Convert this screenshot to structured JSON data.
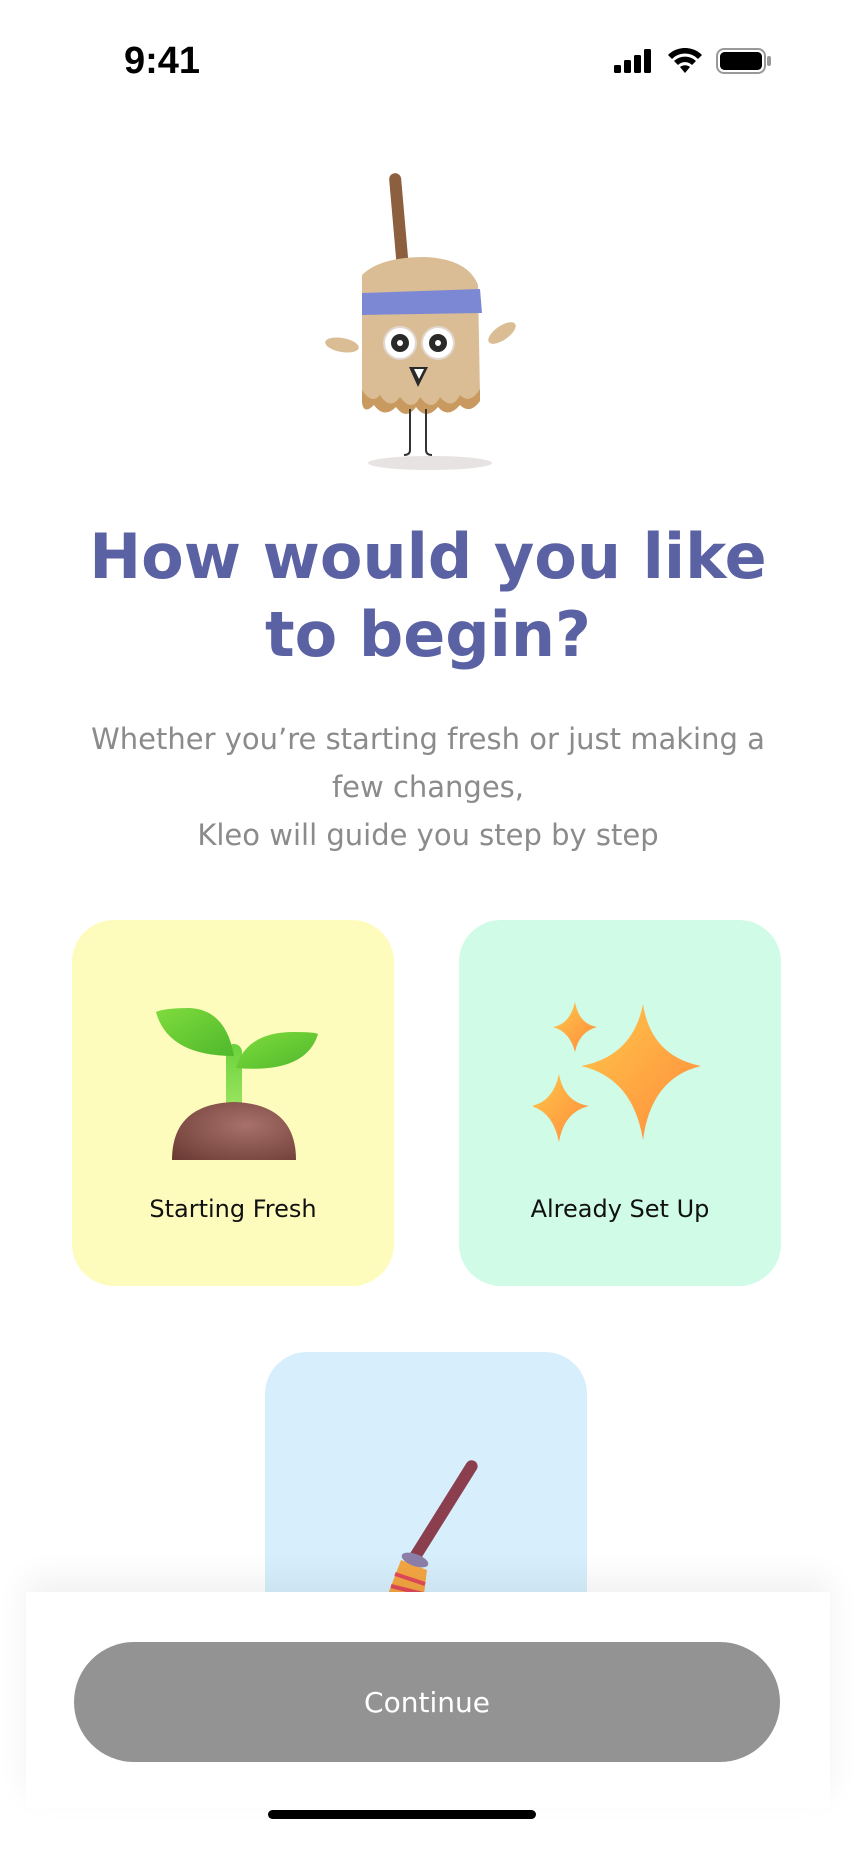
{
  "status_bar": {
    "time": "9:41",
    "icons": [
      "signal-icon",
      "wifi-icon",
      "battery-icon"
    ]
  },
  "mascot": {
    "icon": "broom-mascot-illustration"
  },
  "header": {
    "title": "How would you like to begin?",
    "subtitle_lines": [
      "Whether you’re starting fresh or just making a",
      "few changes,",
      "Kleo will guide you step by step"
    ]
  },
  "options": [
    {
      "label": "Starting Fresh",
      "icon": "sprout-icon",
      "color": "#fdfcbd"
    },
    {
      "label": "Already Set Up",
      "icon": "sparkles-icon",
      "color": "#cffbe7"
    },
    {
      "label": "",
      "icon": "broom-icon",
      "color": "#d7effc"
    }
  ],
  "footer": {
    "continue_label": "Continue",
    "button_color": "#939393"
  },
  "colors": {
    "title": "#5a62a4",
    "subtitle": "#8b8b8b"
  }
}
